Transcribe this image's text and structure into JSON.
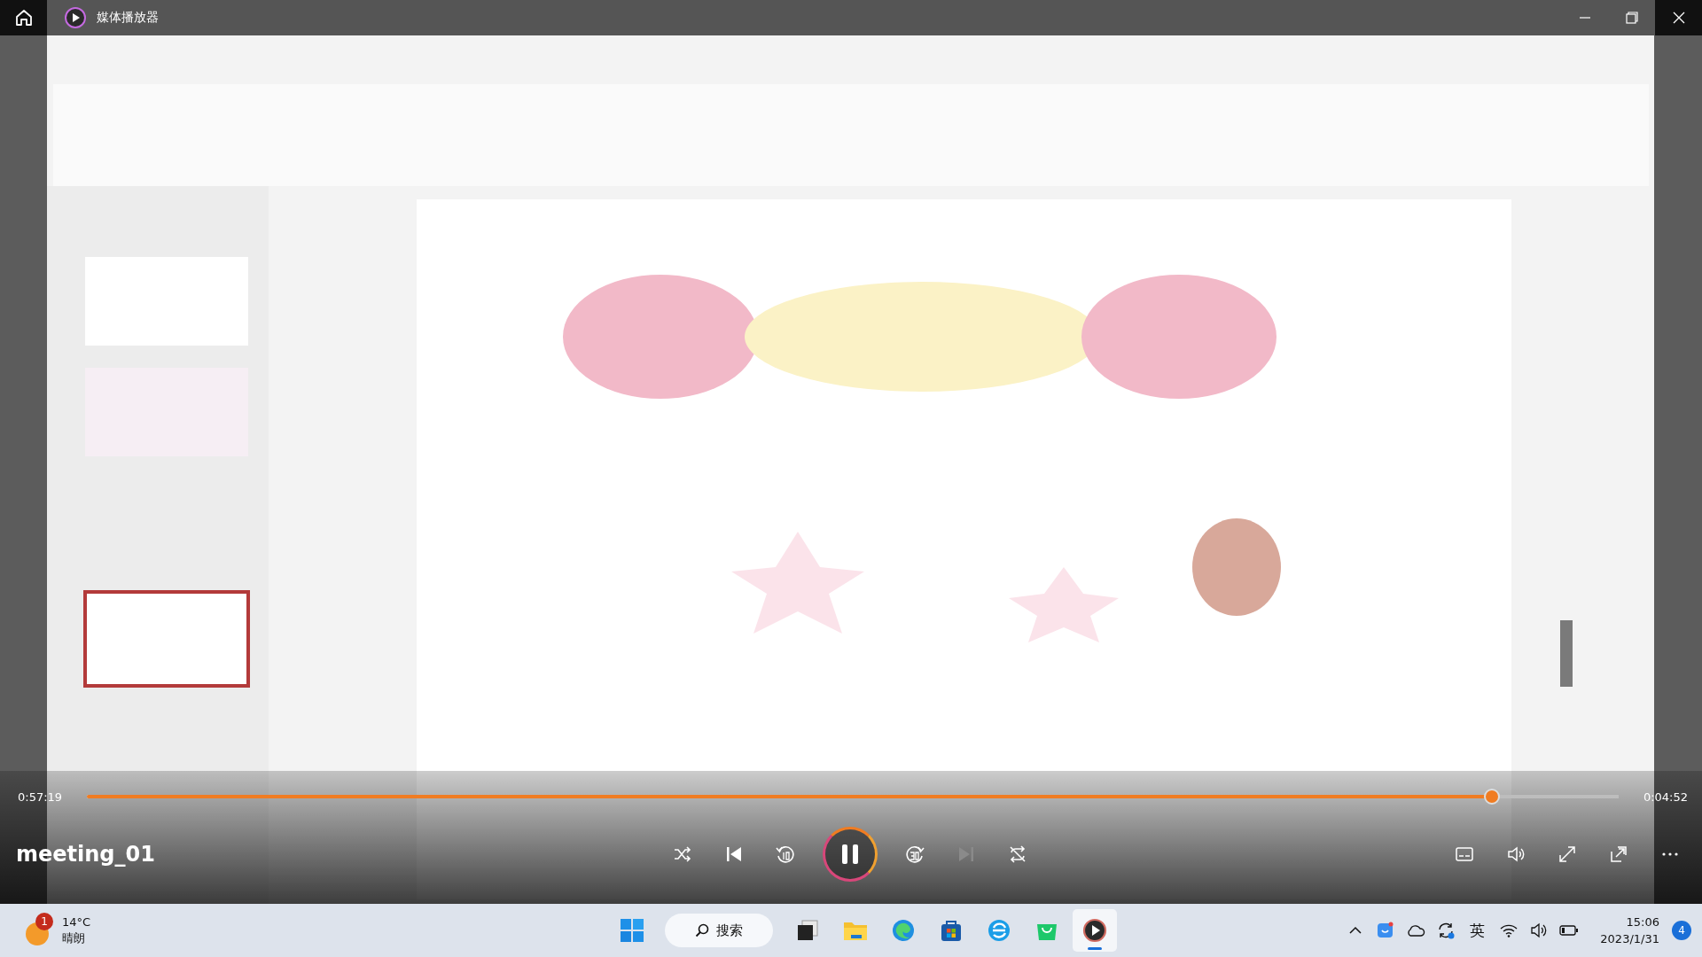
{
  "title_bar": {
    "app_title": "媒体播放器"
  },
  "player": {
    "elapsed": "0:57:19",
    "remaining": "0:04:52",
    "progress": {
      "level": 0.917
    },
    "media_title": "meeting_01",
    "playing": true
  },
  "taskbar": {
    "weather": {
      "temperature": "14°C",
      "condition": "晴朗",
      "badge": "1"
    },
    "search": {
      "label": "搜索"
    },
    "apps": [
      {
        "kind": "taskview",
        "active": false
      },
      {
        "kind": "folder",
        "active": false
      },
      {
        "kind": "edge",
        "active": false
      },
      {
        "kind": "store",
        "active": false
      },
      {
        "kind": "browser",
        "active": false
      },
      {
        "kind": "shop",
        "active": false
      },
      {
        "kind": "player",
        "active": true
      }
    ],
    "input_method": "英",
    "time": "15:06",
    "date": "2023/1/31",
    "notifications": "4"
  }
}
